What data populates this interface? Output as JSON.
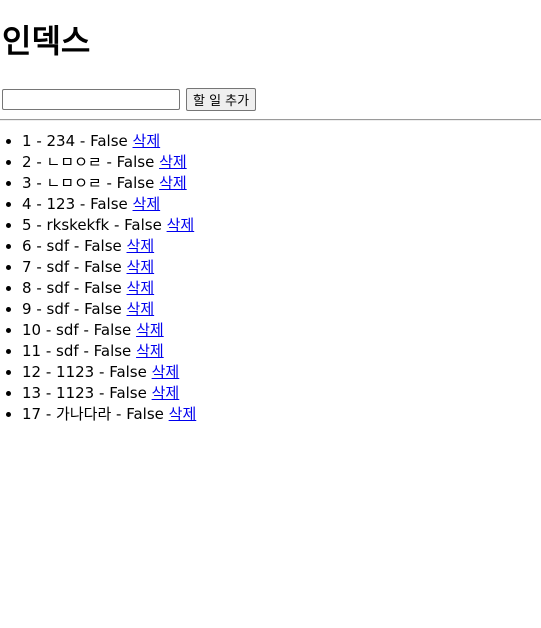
{
  "title": "인덱스",
  "form": {
    "input_value": "",
    "input_placeholder": "",
    "add_label": "할 일 추가"
  },
  "todos": [
    {
      "id": "1",
      "text": "234",
      "done": "False",
      "delete_label": "삭제"
    },
    {
      "id": "2",
      "text": "ㄴㅁㅇㄹ",
      "done": "False",
      "delete_label": "삭제"
    },
    {
      "id": "3",
      "text": "ㄴㅁㅇㄹ",
      "done": "False",
      "delete_label": "삭제"
    },
    {
      "id": "4",
      "text": "123",
      "done": "False",
      "delete_label": "삭제"
    },
    {
      "id": "5",
      "text": "rkskekfk",
      "done": "False",
      "delete_label": "삭제"
    },
    {
      "id": "6",
      "text": "sdf",
      "done": "False",
      "delete_label": "삭제"
    },
    {
      "id": "7",
      "text": "sdf",
      "done": "False",
      "delete_label": "삭제"
    },
    {
      "id": "8",
      "text": "sdf",
      "done": "False",
      "delete_label": "삭제"
    },
    {
      "id": "9",
      "text": "sdf",
      "done": "False",
      "delete_label": "삭제"
    },
    {
      "id": "10",
      "text": "sdf",
      "done": "False",
      "delete_label": "삭제"
    },
    {
      "id": "11",
      "text": "sdf",
      "done": "False",
      "delete_label": "삭제"
    },
    {
      "id": "12",
      "text": "1123",
      "done": "False",
      "delete_label": "삭제"
    },
    {
      "id": "13",
      "text": "1123",
      "done": "False",
      "delete_label": "삭제"
    },
    {
      "id": "17",
      "text": "가나다라",
      "done": "False",
      "delete_label": "삭제"
    }
  ],
  "colors": {
    "link": "#0000ee",
    "text": "#000000",
    "background": "#ffffff"
  }
}
